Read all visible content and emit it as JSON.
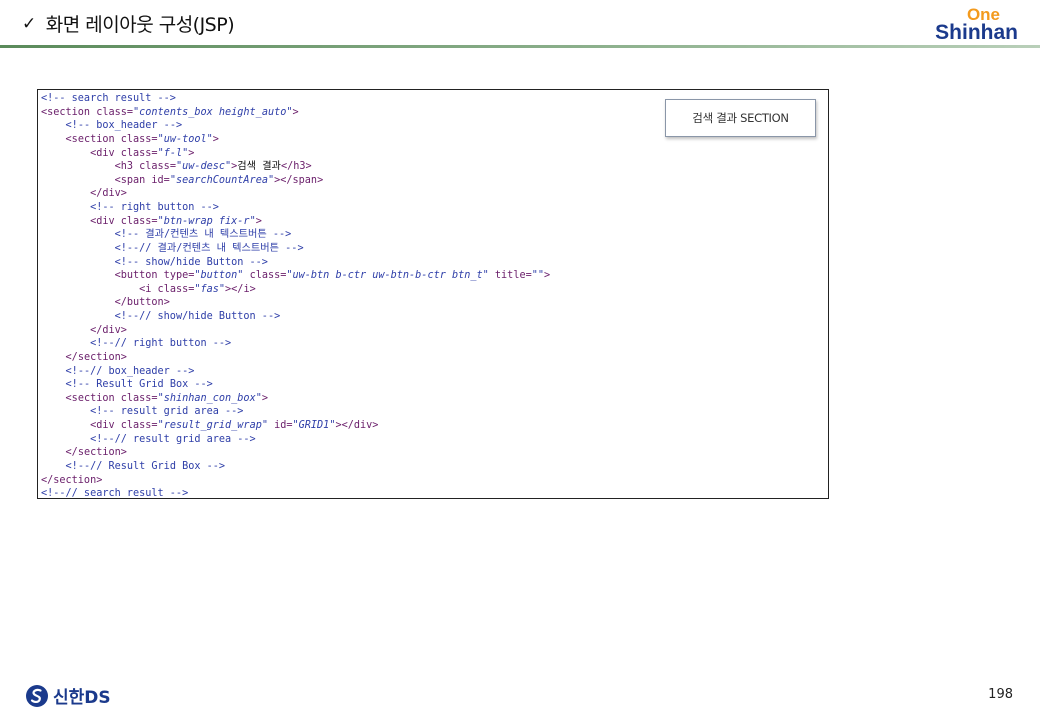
{
  "header": {
    "check_icon": "✓",
    "title": "화면 레이아웃 구성(JSP)",
    "logo_top": "One",
    "logo_bottom": "Shinhan"
  },
  "callout": {
    "label": "검색 결과 SECTION"
  },
  "code": {
    "lines": [
      "<!-- search result -->",
      "<section class=\"contents_box height_auto\">",
      "    <!-- box_header -->",
      "    <section class=\"uw-tool\">",
      "        <div class=\"f-l\">",
      "            <h3 class=\"uw-desc\">검색 결과</h3>",
      "            <span id=\"searchCountArea\"></span>",
      "        </div>",
      "        <!-- right button -->",
      "        <div class=\"btn-wrap fix-r\">",
      "            <!-- 결과/컨텐츠 내 텍스트버튼 -->",
      "            <!--// 결과/컨텐츠 내 텍스트버튼 -->",
      "            <!-- show/hide Button -->",
      "            <button type=\"button\" class=\"uw-btn b-ctr uw-btn-b-ctr btn_t\" title=\"\">",
      "                <i class=\"fas\"></i>",
      "            </button>",
      "            <!--// show/hide Button -->",
      "        </div>",
      "        <!--// right button -->",
      "    </section>",
      "    <!--// box_header -->",
      "    <!-- Result Grid Box -->",
      "    <section class=\"shinhan_con_box\">",
      "        <!-- result grid area -->",
      "        <div class=\"result_grid_wrap\" id=\"GRID1\"></div>",
      "        <!--// result grid area -->",
      "    </section>",
      "    <!--// Result Grid Box -->",
      "</section>",
      "<!--// search result -->"
    ]
  },
  "footer": {
    "logo_text": "신한DS",
    "page_number": "198"
  },
  "colors": {
    "comment": "#2e3ea8",
    "tag": "#6a1e6a",
    "string": "#2e3ea8",
    "brand_blue": "#1b3a8c",
    "brand_orange": "#f39a1d",
    "header_line": "#5a8a5a"
  }
}
